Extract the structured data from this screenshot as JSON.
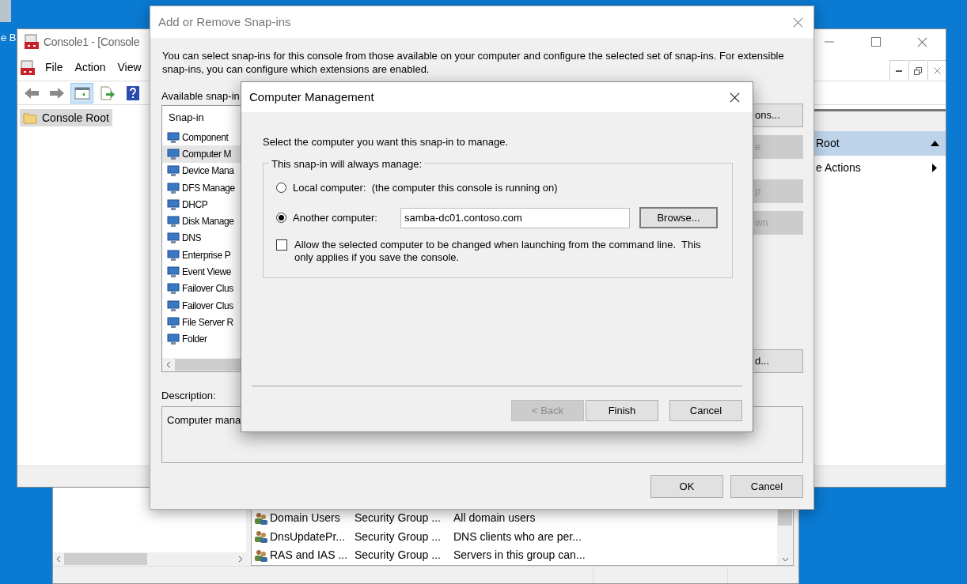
{
  "desktop": {
    "icon_label": "e B"
  },
  "back_window": {
    "rows": [
      {
        "name": "Domain Users",
        "type": "Security Group ...",
        "description": "All domain users"
      },
      {
        "name": "DnsUpdatePr...",
        "type": "Security Group ...",
        "description": "DNS clients who are per..."
      },
      {
        "name": "RAS and IAS ...",
        "type": "Security Group ...",
        "description": "Servers in this group can..."
      }
    ]
  },
  "console": {
    "title": "Console1 - [Console",
    "menu": [
      "File",
      "Action",
      "View"
    ],
    "toolbar": [
      {
        "selected": false
      },
      {
        "selected": false
      },
      {
        "selected": true
      },
      {
        "selected": false
      },
      {
        "selected": false
      }
    ],
    "tree": [
      {
        "label": "Console Root",
        "selected": true
      }
    ],
    "actions": {
      "header": "Root",
      "items": [
        "e Actions"
      ]
    }
  },
  "snapins_dialog": {
    "title": "Add or Remove Snap-ins",
    "intro": "You can select snap-ins for this console from those available on your computer and configure the selected set of snap-ins. For extensible snap-ins, you can configure which extensions are enabled.",
    "available_label": "Available snap-in",
    "column": "Snap-in",
    "items": [
      {
        "label": "Component",
        "selected": false
      },
      {
        "label": "Computer M",
        "selected": true
      },
      {
        "label": "Device Mana",
        "selected": false
      },
      {
        "label": "DFS Manage",
        "selected": false
      },
      {
        "label": "DHCP",
        "selected": false
      },
      {
        "label": "Disk Manage",
        "selected": false
      },
      {
        "label": "DNS",
        "selected": false
      },
      {
        "label": "Enterprise P",
        "selected": false
      },
      {
        "label": "Event Viewe",
        "selected": false
      },
      {
        "label": "Failover Clus",
        "selected": false
      },
      {
        "label": "Failover Clus",
        "selected": false
      },
      {
        "label": "File Server R",
        "selected": false
      },
      {
        "label": "Folder",
        "selected": false
      }
    ],
    "side_buttons": [
      {
        "label": "ons...",
        "disabled": false
      },
      {
        "label": "e",
        "disabled": true
      },
      {
        "label": "p",
        "disabled": true
      },
      {
        "label": "wn",
        "disabled": true
      },
      {
        "label": "d...",
        "disabled": false
      }
    ],
    "description_label": "Description:",
    "description": "Computer mana",
    "buttons": [
      "OK",
      "Cancel"
    ]
  },
  "computer_dialog": {
    "title": "Computer Management",
    "prompt": "Select the computer you want this snap-in to manage.",
    "group_label": "This snap-in will always manage:",
    "options": [
      {
        "label": "Local computer:  (the computer this console is running on)",
        "selected": false
      },
      {
        "label": "Another computer:",
        "selected": true
      }
    ],
    "computer_name": "samba-dc01.contoso.com",
    "browse": "Browse...",
    "allow_change": {
      "label": "Allow the selected computer to be changed when launching from the command line.  This only applies if you save the console.",
      "checked": false
    },
    "buttons": [
      {
        "label": "< Back",
        "disabled": true
      },
      {
        "label": "Finish",
        "disabled": false
      },
      {
        "label": "Cancel",
        "disabled": false
      }
    ]
  }
}
